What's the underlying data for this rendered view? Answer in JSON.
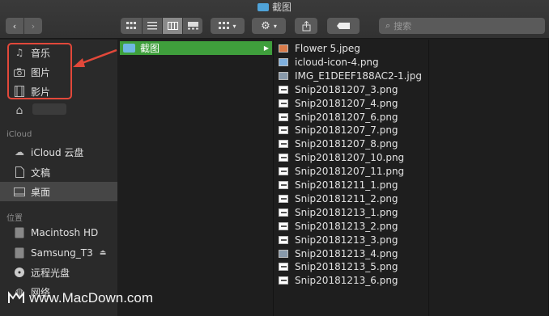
{
  "window": {
    "title": "截图"
  },
  "toolbar": {
    "back": "‹",
    "forward": "›",
    "search_placeholder": "搜索"
  },
  "sidebar": {
    "favorites": [
      {
        "label": "音乐",
        "icon": "music-note-icon"
      },
      {
        "label": "图片",
        "icon": "camera-icon"
      },
      {
        "label": "影片",
        "icon": "film-icon"
      }
    ],
    "home_label": "",
    "icloud_header": "iCloud",
    "icloud": [
      {
        "label": "iCloud 云盘",
        "icon": "cloud-icon"
      },
      {
        "label": "文稿",
        "icon": "document-icon"
      },
      {
        "label": "桌面",
        "icon": "desktop-icon"
      }
    ],
    "locations_header": "位置",
    "locations": [
      {
        "label": "Macintosh HD",
        "icon": "hard-drive-icon"
      },
      {
        "label": "Samsung_T3",
        "icon": "hard-drive-icon"
      },
      {
        "label": "远程光盘",
        "icon": "disc-icon"
      },
      {
        "label": "网络",
        "icon": "globe-icon"
      }
    ]
  },
  "columns": {
    "col1_selected": "截图",
    "files": [
      {
        "name": "Flower 5.jpeg",
        "type": "img"
      },
      {
        "name": "icloud-icon-4.png",
        "type": "icon"
      },
      {
        "name": "IMG_E1DEEF188AC2-1.jpg",
        "type": "photo"
      },
      {
        "name": "Snip20181207_3.png",
        "type": "snip"
      },
      {
        "name": "Snip20181207_4.png",
        "type": "snip"
      },
      {
        "name": "Snip20181207_6.png",
        "type": "snip"
      },
      {
        "name": "Snip20181207_7.png",
        "type": "snip"
      },
      {
        "name": "Snip20181207_8.png",
        "type": "snip"
      },
      {
        "name": "Snip20181207_10.png",
        "type": "snip"
      },
      {
        "name": "Snip20181207_11.png",
        "type": "snip"
      },
      {
        "name": "Snip20181211_1.png",
        "type": "snip"
      },
      {
        "name": "Snip20181211_2.png",
        "type": "snip"
      },
      {
        "name": "Snip20181213_1.png",
        "type": "snip"
      },
      {
        "name": "Snip20181213_2.png",
        "type": "snip"
      },
      {
        "name": "Snip20181213_3.png",
        "type": "snip"
      },
      {
        "name": "Snip20181213_4.png",
        "type": "photo"
      },
      {
        "name": "Snip20181213_5.png",
        "type": "snip"
      },
      {
        "name": "Snip20181213_6.png",
        "type": "snip"
      }
    ]
  },
  "watermark": "www.MacDown.com",
  "colors": {
    "accent_green": "#3f9f3c",
    "annotation_red": "#e2483a",
    "folder_blue": "#6fb7e3"
  }
}
